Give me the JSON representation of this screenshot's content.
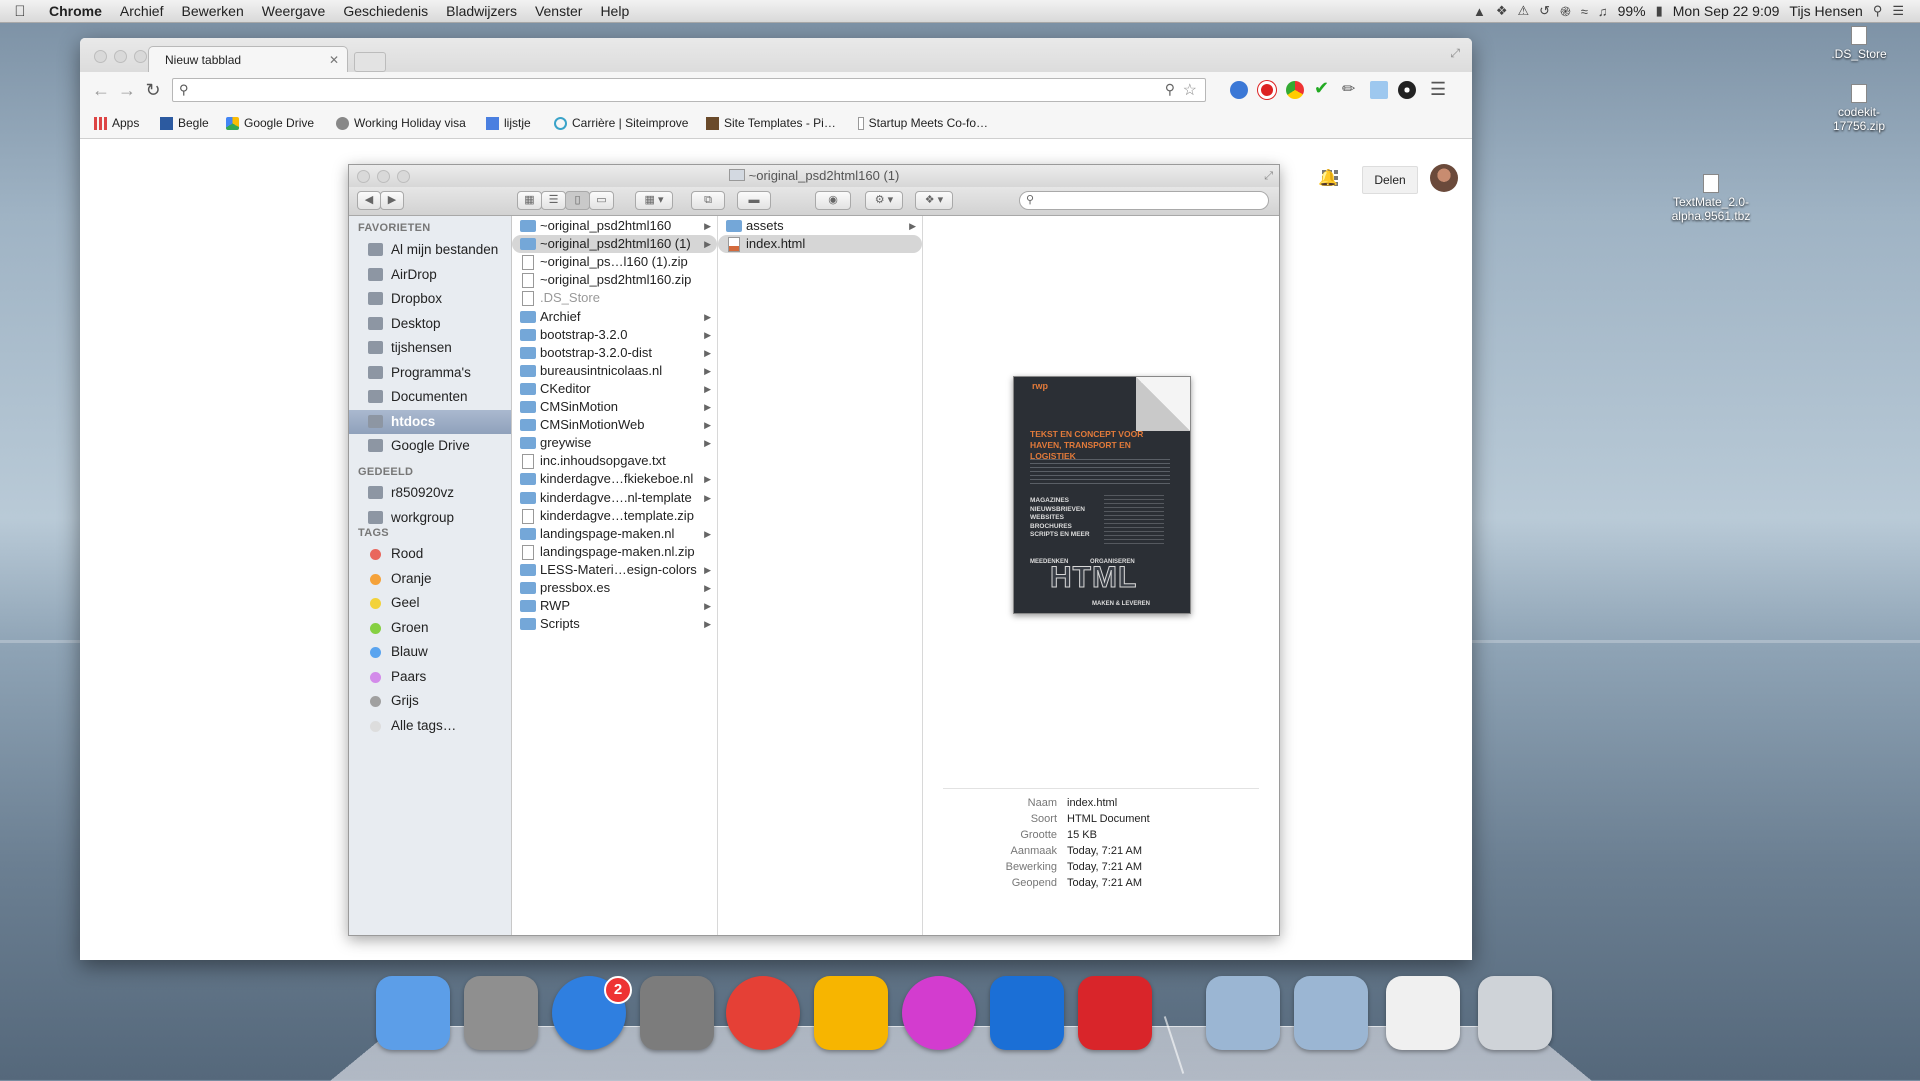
{
  "menubar": {
    "app": "Chrome",
    "items": [
      "Archief",
      "Bewerken",
      "Weergave",
      "Geschiedenis",
      "Bladwijzers",
      "Venster",
      "Help"
    ],
    "battery": "99%",
    "datetime": "Mon Sep 22  9:09",
    "user": "Tijs Hensen"
  },
  "desktop": {
    "items": [
      ".DS_Store",
      "codekit-17756.zip",
      "TextMate_2.0-alpha.9561.tbz"
    ]
  },
  "chrome": {
    "tab_title": "Nieuw tabblad",
    "bookmarks": [
      "Apps",
      "Begle",
      "Google Drive",
      "Working Holiday visa",
      "lijstje",
      "Carrière | Siteimprove",
      "Site Templates - Pi…",
      "Startup Meets Co-fo…"
    ],
    "page": {
      "share_label": "Delen"
    }
  },
  "finder": {
    "title": "~original_psd2html160 (1)",
    "sidebar": {
      "favorites_heading": "FAVORIETEN",
      "favorites": [
        "Al mijn bestanden",
        "AirDrop",
        "Dropbox",
        "Desktop",
        "tijshensen",
        "Programma's",
        "Documenten",
        "htdocs",
        "Google Drive"
      ],
      "shared_heading": "GEDEELD",
      "shared": [
        "r850920vz",
        "workgroup"
      ],
      "tags_heading": "TAGS",
      "tags": [
        {
          "label": "Rood",
          "color": "#e9675d"
        },
        {
          "label": "Oranje",
          "color": "#f5a23a"
        },
        {
          "label": "Geel",
          "color": "#f2d23b"
        },
        {
          "label": "Groen",
          "color": "#86d042"
        },
        {
          "label": "Blauw",
          "color": "#5aa4ef"
        },
        {
          "label": "Paars",
          "color": "#d38bea"
        },
        {
          "label": "Grijs",
          "color": "#a0a0a0"
        },
        {
          "label": "Alle tags…",
          "color": "#dddddd"
        }
      ]
    },
    "column1": [
      {
        "name": "~original_psd2html160",
        "type": "folder"
      },
      {
        "name": "~original_psd2html160 (1)",
        "type": "folder",
        "selected": true
      },
      {
        "name": "~original_ps…l160 (1).zip",
        "type": "file"
      },
      {
        "name": "~original_psd2html160.zip",
        "type": "file"
      },
      {
        "name": ".DS_Store",
        "type": "file"
      },
      {
        "name": "Archief",
        "type": "folder"
      },
      {
        "name": "bootstrap-3.2.0",
        "type": "folder"
      },
      {
        "name": "bootstrap-3.2.0-dist",
        "type": "folder"
      },
      {
        "name": "bureausintnicolaas.nl",
        "type": "folder"
      },
      {
        "name": "CKeditor",
        "type": "folder"
      },
      {
        "name": "CMSinMotion",
        "type": "folder"
      },
      {
        "name": "CMSinMotionWeb",
        "type": "folder"
      },
      {
        "name": "greywise",
        "type": "folder"
      },
      {
        "name": "inc.inhoudsopgave.txt",
        "type": "file"
      },
      {
        "name": "kinderdagve…fkiekeboe.nl",
        "type": "folder"
      },
      {
        "name": "kinderdagve….nl-template",
        "type": "folder"
      },
      {
        "name": "kinderdagve…template.zip",
        "type": "file"
      },
      {
        "name": "landingspage-maken.nl",
        "type": "folder"
      },
      {
        "name": "landingspage-maken.nl.zip",
        "type": "file"
      },
      {
        "name": "LESS-Materi…esign-colors",
        "type": "folder"
      },
      {
        "name": "pressbox.es",
        "type": "folder"
      },
      {
        "name": "RWP",
        "type": "folder"
      },
      {
        "name": "Scripts",
        "type": "folder"
      }
    ],
    "column2": [
      {
        "name": "assets",
        "type": "folder"
      },
      {
        "name": "index.html",
        "type": "html",
        "selected": true
      }
    ],
    "preview": {
      "poster": {
        "brand": "rwp",
        "headline": "TEKST EN CONCEPT VOOR HAVEN, TRANSPORT EN LOGISTIEK",
        "list": [
          "MAGAZINES",
          "NIEUWSBRIEVEN",
          "WEBSITES",
          "BROCHURES",
          "SCRIPTS EN MEER"
        ],
        "left_sub": "MEEDENKEN",
        "right_sub": "ORGANISEREN",
        "big": "HTML",
        "bottom_sub": "MAKEN & LEVEREN"
      },
      "info": [
        {
          "key": "Naam",
          "value": "index.html"
        },
        {
          "key": "Soort",
          "value": "HTML Document"
        },
        {
          "key": "Grootte",
          "value": "15 KB"
        },
        {
          "key": "Aanmaak",
          "value": "Today, 7:21 AM"
        },
        {
          "key": "Bewerking",
          "value": "Today, 7:21 AM"
        },
        {
          "key": "Geopend",
          "value": "Today, 7:21 AM"
        }
      ]
    }
  },
  "dock": {
    "badge": "2",
    "apps": [
      {
        "name": "finder-icon",
        "color": "#5c9ee8"
      },
      {
        "name": "launchpad-icon",
        "color": "#8f8f8f"
      },
      {
        "name": "app-store-icon",
        "color": "#2f7fe0"
      },
      {
        "name": "system-preferences-icon",
        "color": "#7c7c7c"
      },
      {
        "name": "chrome-icon",
        "color": "#e54036"
      },
      {
        "name": "codekit-icon",
        "color": "#f7b500"
      },
      {
        "name": "flower-app-icon",
        "color": "#d33ccf"
      },
      {
        "name": "teamviewer-icon",
        "color": "#1b6fd6"
      },
      {
        "name": "acrobat-icon",
        "color": "#d9252a"
      },
      {
        "name": "documents-folder-icon",
        "color": "#9bb6d3"
      },
      {
        "name": "downloads-folder-icon",
        "color": "#9bb6d3"
      },
      {
        "name": "recent-doc-icon",
        "color": "#f0f0f0"
      },
      {
        "name": "trash-icon",
        "color": "#cfd3d8"
      }
    ]
  }
}
